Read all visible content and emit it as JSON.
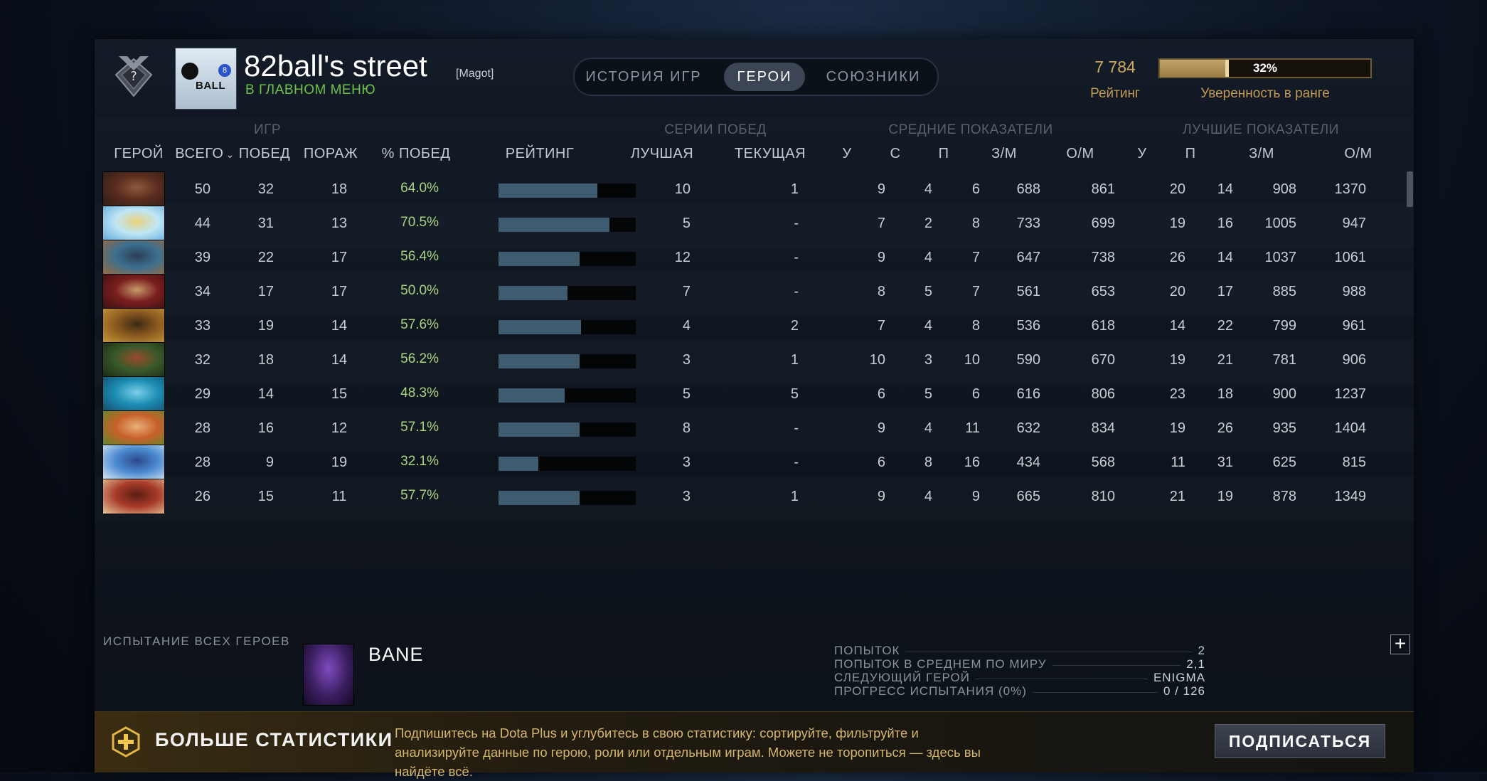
{
  "header": {
    "player_name": "82ball's street",
    "player_tag": "[Magot]",
    "status": "В ГЛАВНОМ МЕНЮ",
    "avatar_text": "BALL",
    "avatar_ball_number": "8",
    "tabs": [
      {
        "label": "ИСТОРИЯ ИГР",
        "active": false
      },
      {
        "label": "ГЕРОИ",
        "active": true
      },
      {
        "label": "СОЮЗНИКИ",
        "active": false
      }
    ],
    "rating_value": "7 784",
    "rating_label": "Рейтинг",
    "confidence_value": "32%",
    "confidence_fraction": 0.32,
    "confidence_label": "Уверенность в ранге",
    "colors": {
      "accent_gold": "#d0a85c",
      "status_green": "#6cc24a",
      "winrate_green": "#a9d480"
    }
  },
  "table": {
    "group_headers": {
      "games": "ИГР",
      "streaks": "СЕРИИ ПОБЕД",
      "averages": "СРЕДНИЕ ПОКАЗАТЕЛИ",
      "bests": "ЛУЧШИЕ ПОКАЗАТЕЛИ"
    },
    "columns": {
      "hero": "ГЕРОЙ",
      "total": "ВСЕГО",
      "wins": "ПОБЕД",
      "losses": "ПОРАЖ",
      "winrate": "% ПОБЕД",
      "rating": "РЕЙТИНГ",
      "best_streak": "ЛУЧШАЯ",
      "current_streak": "ТЕКУЩАЯ",
      "avg_kills": "У",
      "avg_deaths": "С",
      "avg_assists": "П",
      "avg_gpm": "З/М",
      "avg_xpm": "О/М",
      "best_kills": "У",
      "best_assists": "П",
      "best_gpm": "З/М",
      "best_xpm": "О/М"
    },
    "sort_icon": "chevron-down-icon",
    "rows": [
      {
        "hero_icon": "hero-portrait-brown-beast",
        "colors": [
          "#5a2d1e",
          "#2b1a16",
          "#8c5a3a"
        ],
        "total": "50",
        "wins": "32",
        "losses": "18",
        "winrate": "64.0%",
        "rating_fraction": 0.72,
        "best_streak": "10",
        "current_streak": "1",
        "avg_k": "9",
        "avg_d": "4",
        "avg_a": "6",
        "avg_gpm": "688",
        "avg_xpm": "861",
        "best_k": "20",
        "best_a": "14",
        "best_gpm": "908",
        "best_xpm": "1370"
      },
      {
        "hero_icon": "hero-portrait-ice-maiden",
        "colors": [
          "#bfe6f5",
          "#5fa9d9",
          "#e8d27a"
        ],
        "total": "44",
        "wins": "31",
        "losses": "13",
        "winrate": "70.5%",
        "rating_fraction": 0.81,
        "best_streak": "5",
        "current_streak": "-",
        "avg_k": "7",
        "avg_d": "2",
        "avg_a": "8",
        "avg_gpm": "733",
        "avg_xpm": "699",
        "best_k": "19",
        "best_a": "16",
        "best_gpm": "1005",
        "best_xpm": "947"
      },
      {
        "hero_icon": "hero-portrait-blue-knight",
        "colors": [
          "#3d6f8f",
          "#9a6a3a",
          "#2a3f55"
        ],
        "total": "39",
        "wins": "22",
        "losses": "17",
        "winrate": "56.4%",
        "rating_fraction": 0.59,
        "best_streak": "12",
        "current_streak": "-",
        "avg_k": "9",
        "avg_d": "4",
        "avg_a": "7",
        "avg_gpm": "647",
        "avg_xpm": "738",
        "best_k": "26",
        "best_a": "14",
        "best_gpm": "1037",
        "best_xpm": "1061"
      },
      {
        "hero_icon": "hero-portrait-red-warrior",
        "colors": [
          "#7a1e1e",
          "#3a1010",
          "#c89a6a"
        ],
        "total": "34",
        "wins": "17",
        "losses": "17",
        "winrate": "50.0%",
        "rating_fraction": 0.5,
        "best_streak": "7",
        "current_streak": "-",
        "avg_k": "8",
        "avg_d": "5",
        "avg_a": "7",
        "avg_gpm": "561",
        "avg_xpm": "653",
        "best_k": "20",
        "best_a": "17",
        "best_gpm": "885",
        "best_xpm": "988"
      },
      {
        "hero_icon": "hero-portrait-golden-brute",
        "colors": [
          "#8c5a1e",
          "#c89a3a",
          "#3a2a14"
        ],
        "total": "33",
        "wins": "19",
        "losses": "14",
        "winrate": "57.6%",
        "rating_fraction": 0.6,
        "best_streak": "4",
        "current_streak": "2",
        "avg_k": "7",
        "avg_d": "4",
        "avg_a": "8",
        "avg_gpm": "536",
        "avg_xpm": "618",
        "best_k": "14",
        "best_a": "22",
        "best_gpm": "799",
        "best_xpm": "961"
      },
      {
        "hero_icon": "hero-portrait-green-orc",
        "colors": [
          "#3a5a2a",
          "#1a2a16",
          "#9a4a2a"
        ],
        "total": "32",
        "wins": "18",
        "losses": "14",
        "winrate": "56.2%",
        "rating_fraction": 0.59,
        "best_streak": "3",
        "current_streak": "1",
        "avg_k": "10",
        "avg_d": "3",
        "avg_a": "10",
        "avg_gpm": "590",
        "avg_xpm": "670",
        "best_k": "19",
        "best_a": "21",
        "best_gpm": "781",
        "best_xpm": "906"
      },
      {
        "hero_icon": "hero-portrait-water-spirit",
        "colors": [
          "#1e8fb5",
          "#0f4a6a",
          "#7ad0e8"
        ],
        "total": "29",
        "wins": "14",
        "losses": "15",
        "winrate": "48.3%",
        "rating_fraction": 0.48,
        "best_streak": "5",
        "current_streak": "5",
        "avg_k": "6",
        "avg_d": "5",
        "avg_a": "6",
        "avg_gpm": "616",
        "avg_xpm": "806",
        "best_k": "23",
        "best_a": "18",
        "best_gpm": "900",
        "best_xpm": "1237"
      },
      {
        "hero_icon": "hero-portrait-red-haired-ranger",
        "colors": [
          "#c8602a",
          "#5a8a2a",
          "#e8b07a"
        ],
        "total": "28",
        "wins": "16",
        "losses": "12",
        "winrate": "57.1%",
        "rating_fraction": 0.59,
        "best_streak": "8",
        "current_streak": "-",
        "avg_k": "9",
        "avg_d": "4",
        "avg_a": "11",
        "avg_gpm": "632",
        "avg_xpm": "834",
        "best_k": "19",
        "best_a": "26",
        "best_gpm": "935",
        "best_xpm": "1404"
      },
      {
        "hero_icon": "hero-portrait-storm-sage",
        "colors": [
          "#4a8ad0",
          "#d8e8f5",
          "#2a4a8a"
        ],
        "total": "28",
        "wins": "9",
        "losses": "19",
        "winrate": "32.1%",
        "rating_fraction": 0.29,
        "best_streak": "3",
        "current_streak": "-",
        "avg_k": "6",
        "avg_d": "8",
        "avg_a": "16",
        "avg_gpm": "434",
        "avg_xpm": "568",
        "best_k": "11",
        "best_a": "31",
        "best_gpm": "625",
        "best_xpm": "815"
      },
      {
        "hero_icon": "hero-portrait-horned-brute",
        "colors": [
          "#a83a2a",
          "#e8c89a",
          "#5a1e14"
        ],
        "total": "26",
        "wins": "15",
        "losses": "11",
        "winrate": "57.7%",
        "rating_fraction": 0.59,
        "best_streak": "3",
        "current_streak": "1",
        "avg_k": "9",
        "avg_d": "4",
        "avg_a": "9",
        "avg_gpm": "665",
        "avg_xpm": "810",
        "best_k": "21",
        "best_a": "19",
        "best_gpm": "878",
        "best_xpm": "1349"
      }
    ]
  },
  "challenge": {
    "title": "ИСПЫТАНИЕ ВСЕХ ГЕРОЕВ",
    "hero_name": "BANE",
    "stats": [
      {
        "label": "ПОПЫТОК",
        "value": "2"
      },
      {
        "label": "ПОПЫТОК В СРЕДНЕМ ПО МИРУ",
        "value": "2,1"
      },
      {
        "label": "СЛЕДУЮЩИЙ ГЕРОЙ",
        "value": "ENIGMA"
      },
      {
        "label": "ПРОГРЕСС ИСПЫТАНИЯ (0%)",
        "value": "0 / 126"
      }
    ],
    "expand_icon": "plus-icon",
    "expand_label": "+"
  },
  "banner": {
    "icon": "dota-plus-icon",
    "title": "БОЛЬШЕ СТАТИСТИКИ",
    "text": "Подпишитесь на Dota Plus и углубитесь в свою статистику: сортируйте, фильтруйте и анализируйте данные по герою, роли или отдельным играм. Можете не торопиться — здесь вы найдёте всё.",
    "button_label": "ПОДПИСАТЬСЯ"
  }
}
